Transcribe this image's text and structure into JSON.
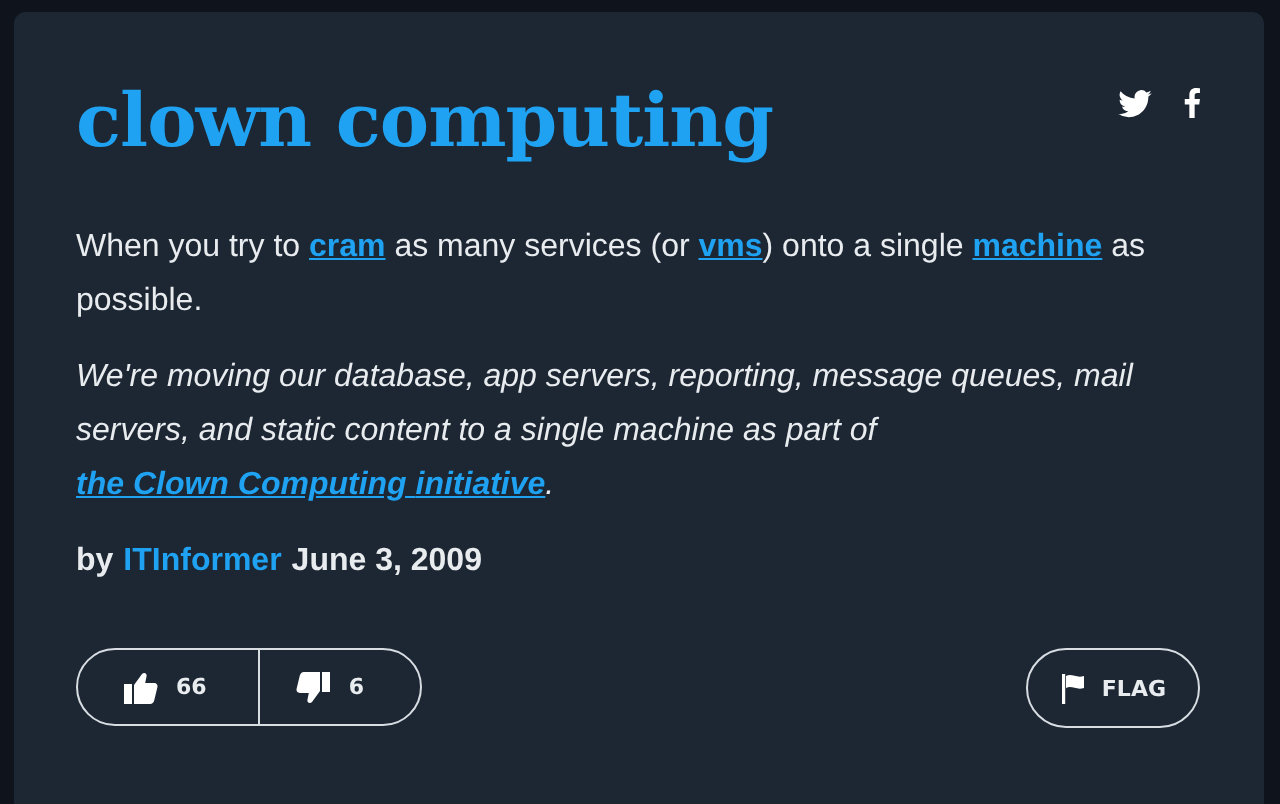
{
  "title": "clown computing",
  "share": [
    {
      "kind": "twitter"
    },
    {
      "kind": "facebook"
    }
  ],
  "definition": [
    {
      "kind": "text",
      "text": "When you try to "
    },
    {
      "kind": "link",
      "text": "cram"
    },
    {
      "kind": "text",
      "text": " as many services (or "
    },
    {
      "kind": "link",
      "text": "vms"
    },
    {
      "kind": "text",
      "text": ") onto a single "
    },
    {
      "kind": "link",
      "text": "machine"
    },
    {
      "kind": "text",
      "text": " as possible."
    }
  ],
  "example": [
    {
      "kind": "text",
      "text": "We're moving our database, app servers, reporting, message queues, mail servers, and static content to a single machine as part of "
    },
    {
      "kind": "link",
      "text": "the Clown Computing "
    },
    {
      "kind": "link",
      "text": "initiative"
    },
    {
      "kind": "text",
      "text": "."
    }
  ],
  "author": {
    "prefix": "by",
    "name": "ITInformer",
    "date": "June 3, 2009"
  },
  "votes": {
    "up": "66",
    "down": "6"
  },
  "flag": {
    "label": "FLAG"
  }
}
